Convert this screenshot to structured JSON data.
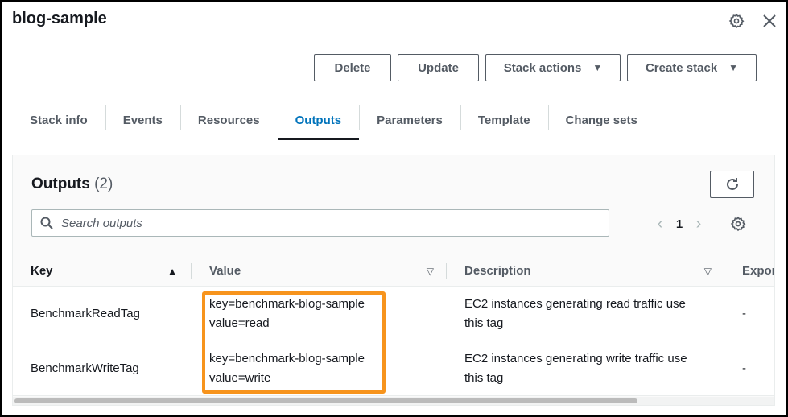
{
  "header": {
    "title": "blog-sample",
    "settings_icon": "gear-icon",
    "close_icon": "close-icon"
  },
  "actions": {
    "delete_label": "Delete",
    "update_label": "Update",
    "stack_actions_label": "Stack actions",
    "create_stack_label": "Create stack",
    "dropdown_caret": "▼"
  },
  "tabs": [
    {
      "label": "Stack info",
      "active": false
    },
    {
      "label": "Events",
      "active": false
    },
    {
      "label": "Resources",
      "active": false
    },
    {
      "label": "Outputs",
      "active": true
    },
    {
      "label": "Parameters",
      "active": false
    },
    {
      "label": "Template",
      "active": false
    },
    {
      "label": "Change sets",
      "active": false
    }
  ],
  "outputs": {
    "title": "Outputs",
    "count": "(2)",
    "search_placeholder": "Search outputs",
    "search_value": "",
    "pagination": {
      "prev": "‹",
      "page": "1",
      "next": "›"
    },
    "columns": [
      {
        "label": "Key",
        "sort": "▲"
      },
      {
        "label": "Value",
        "sort": "▽"
      },
      {
        "label": "Description",
        "sort": "▽"
      },
      {
        "label": "Expor",
        "sort": ""
      }
    ],
    "rows": [
      {
        "key": "BenchmarkReadTag",
        "value_line1": "key=benchmark-blog-sample",
        "value_line2": "value=read",
        "description_line1": "EC2 instances generating read traffic use",
        "description_line2": "this tag",
        "export": "-"
      },
      {
        "key": "BenchmarkWriteTag",
        "value_line1": "key=benchmark-blog-sample",
        "value_line2": "value=write",
        "description_line1": "EC2 instances generating write traffic use",
        "description_line2": "this tag",
        "export": "-"
      }
    ]
  },
  "colors": {
    "accent": "#0073bb",
    "highlight": "#f7941d",
    "text": "#16191f",
    "muted": "#545b64"
  }
}
